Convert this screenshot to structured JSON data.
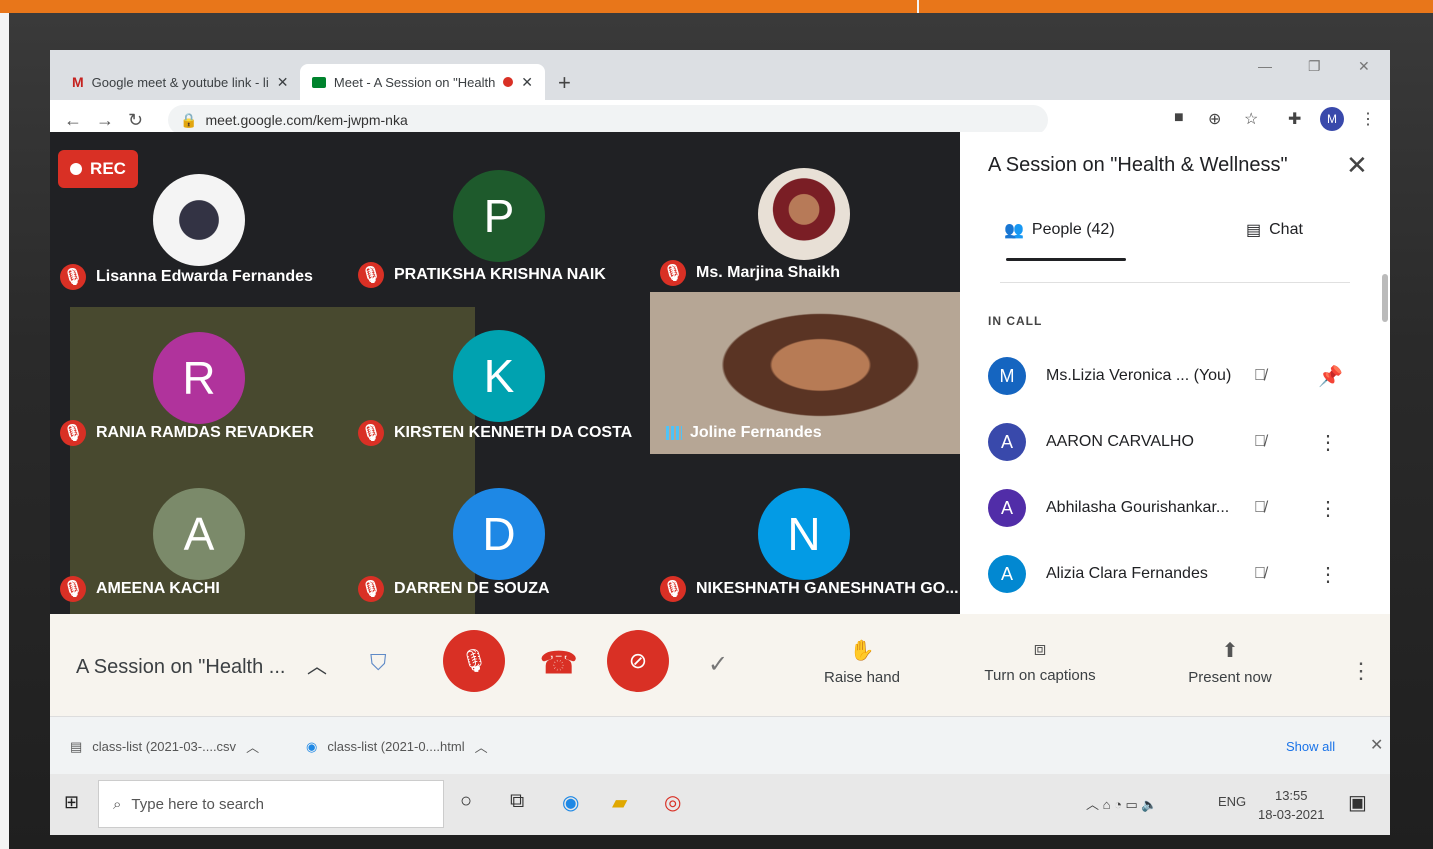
{
  "browser": {
    "tabs": [
      {
        "label": "Google meet & youtube link - li"
      },
      {
        "label": "Meet - A Session on \"Health"
      }
    ],
    "url": "meet.google.com/kem-jwpm-nka",
    "profile_initial": "M"
  },
  "meet": {
    "rec_label": "REC",
    "tiles": [
      {
        "name": "Lisanna Edwarda Fernandes",
        "initial": ""
      },
      {
        "name": "PRATIKSHA KRISHNA NAIK",
        "initial": "P",
        "color": "#1e5a2c"
      },
      {
        "name": "Ms. Marjina Shaikh",
        "initial": ""
      },
      {
        "name": "RANIA RAMDAS REVADKER",
        "initial": "R",
        "color": "#b0339c"
      },
      {
        "name": "KIRSTEN KENNETH DA COSTA",
        "initial": "K",
        "color": "#00a2b0"
      },
      {
        "name": "Joline Fernandes",
        "initial": ""
      },
      {
        "name": "AMEENA KACHI",
        "initial": "A",
        "color": "#7b8a6a"
      },
      {
        "name": "DARREN DE SOUZA",
        "initial": "D",
        "color": "#1e88e5"
      },
      {
        "name": "NIKESHNATH GANESHNATH GO...",
        "initial": "N",
        "color": "#039be5"
      }
    ]
  },
  "panel": {
    "title": "A Session on \"Health & Wellness\"",
    "people_tab": "People (42)",
    "chat_tab": "Chat",
    "section": "IN CALL",
    "people": [
      {
        "initial": "M",
        "name": "Ms.Lizia Veronica ...  (You)",
        "color": "#1565c0"
      },
      {
        "initial": "A",
        "name": "AARON CARVALHO",
        "color": "#3949ab"
      },
      {
        "initial": "A",
        "name": "Abhilasha Gourishankar...",
        "color": "#512da8"
      },
      {
        "initial": "A",
        "name": "Alizia Clara Fernandes",
        "color": "#0288d1"
      }
    ]
  },
  "controls": {
    "meeting_title": "A Session on \"Health ...",
    "raise_hand": "Raise hand",
    "captions": "Turn on captions",
    "present": "Present now"
  },
  "downloads": {
    "items": [
      "class-list (2021-03-....csv",
      "class-list (2021-0....html"
    ],
    "show_all": "Show all"
  },
  "taskbar": {
    "search_placeholder": "Type here to search",
    "lang": "ENG",
    "time": "13:55",
    "date": "18-03-2021"
  }
}
